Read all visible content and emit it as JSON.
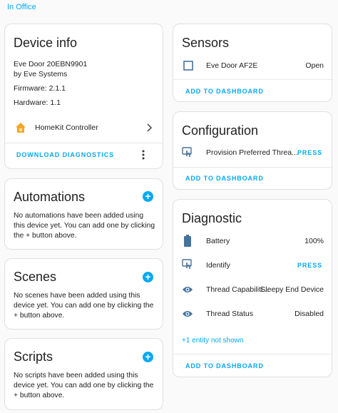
{
  "area_link": "In Office",
  "device_info": {
    "title": "Device info",
    "model": "Eve Door 20EBN9901",
    "manufacturer": "by Eve Systems",
    "firmware": "Firmware: 2.1.1",
    "hardware": "Hardware: 1.1",
    "integration": "HomeKit Controller",
    "download_label": "DOWNLOAD DIAGNOSTICS"
  },
  "automations": {
    "title": "Automations",
    "message": "No automations have been added using this device yet. You can add one by clicking the + button above."
  },
  "scenes": {
    "title": "Scenes",
    "message": "No scenes have been added using this device yet. You can add one by clicking the + button above."
  },
  "scripts": {
    "title": "Scripts",
    "message": "No scripts have been added using this device yet. You can add one by clicking the + button above."
  },
  "sensors": {
    "title": "Sensors",
    "entity_name": "Eve Door AF2E",
    "entity_state": "Open",
    "add_label": "ADD TO DASHBOARD"
  },
  "configuration": {
    "title": "Configuration",
    "entity_name": "Provision Preferred Threa...",
    "entity_action": "PRESS",
    "add_label": "ADD TO DASHBOARD"
  },
  "diagnostic": {
    "title": "Diagnostic",
    "rows": [
      {
        "name": "Battery",
        "value": "100%"
      },
      {
        "name": "Identify",
        "value": "PRESS"
      },
      {
        "name": "Thread Capabiliti...",
        "value": "Sleepy End Device"
      },
      {
        "name": "Thread Status",
        "value": "Disabled"
      }
    ],
    "hidden_entities": "+1 entity not shown",
    "add_label": "ADD TO DASHBOARD"
  },
  "colors": {
    "accent": "#03a9f4",
    "icon": "#44739e",
    "home": "#f5a623"
  }
}
